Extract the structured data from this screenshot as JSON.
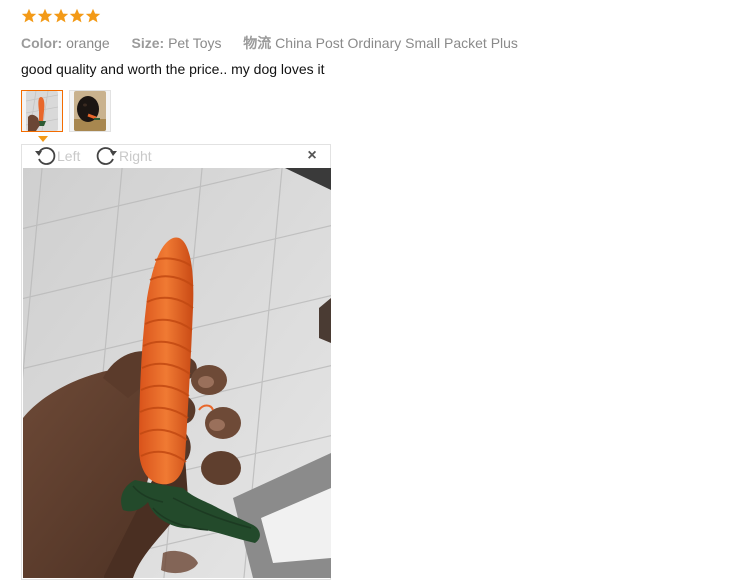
{
  "rating": {
    "stars": 5,
    "max": 5,
    "color": "#f39a17"
  },
  "meta": {
    "color_label": "Color:",
    "color_value": "orange",
    "size_label": "Size:",
    "size_value": "Pet Toys",
    "shipping_label": "物流",
    "shipping_value": "China Post Ordinary Small Packet Plus"
  },
  "review": {
    "text": "good quality and worth the price.. my dog loves it"
  },
  "thumbnails": [
    {
      "name": "carrot-toy-photo",
      "selected": true
    },
    {
      "name": "dog-photo",
      "selected": false
    }
  ],
  "viewer": {
    "rotate_left_label": "Left",
    "rotate_right_label": "Right",
    "close_label": "×",
    "accent": "#f36c00"
  }
}
